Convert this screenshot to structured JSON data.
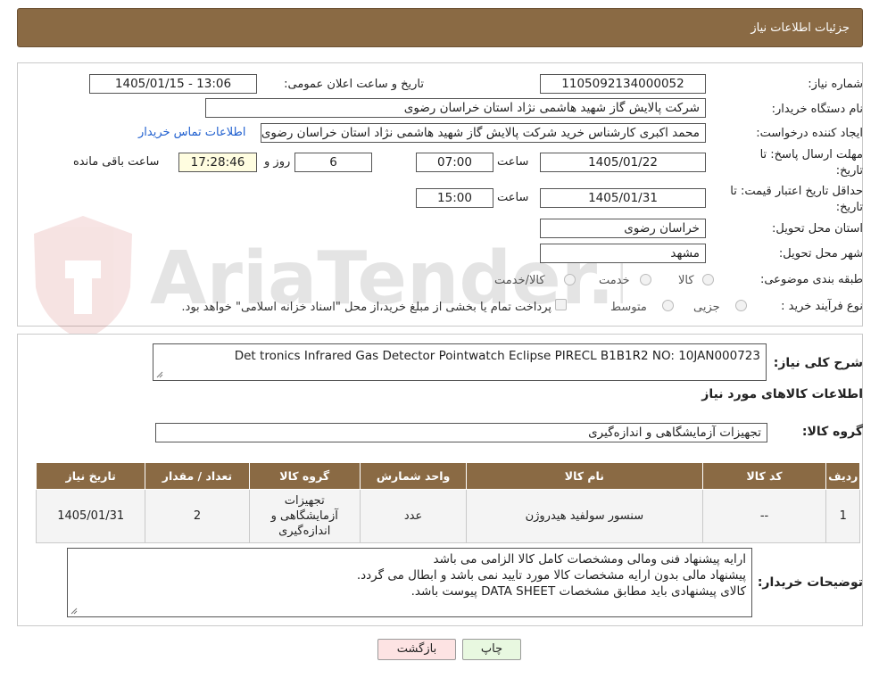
{
  "header": {
    "title": "جزئیات اطلاعات نیاز"
  },
  "form": {
    "need_number_label": "شماره نیاز:",
    "need_number": "1105092134000052",
    "announce_label": "تاریخ و ساعت اعلان عمومی:",
    "announce_value": "1405/01/15 - 13:06",
    "buyer_org_label": "نام دستگاه خریدار:",
    "buyer_org": "شرکت پالایش گاز شهید هاشمی نژاد   استان خراسان رضوی",
    "creator_label": "ایجاد کننده درخواست:",
    "creator": "محمد اکبری کارشناس خرید شرکت پالایش گاز شهید هاشمی نژاد   استان خراسان رضوی",
    "contact_link": "اطلاعات تماس خریدار",
    "deadline_label": "مهلت ارسال پاسخ: تا تاریخ:",
    "deadline_date": "1405/01/22",
    "time_label": "ساعت",
    "deadline_time": "07:00",
    "days_value": "6",
    "days_label": "روز و",
    "remaining_time": "17:28:46",
    "remaining_label": "ساعت باقی مانده",
    "validity_label": "حداقل تاریخ اعتبار قیمت: تا تاریخ:",
    "validity_date": "1405/01/31",
    "validity_time": "15:00",
    "province_label": "استان محل تحویل:",
    "province": "خراسان رضوی",
    "city_label": "شهر محل تحویل:",
    "city": "مشهد",
    "category_label": "طبقه بندی موضوعی:",
    "category_options": [
      "کالا",
      "خدمت",
      "کالا/خدمت"
    ],
    "process_label": "نوع فرآیند خرید :",
    "process_options": [
      "جزیی",
      "متوسط"
    ],
    "payment_note": "پرداخت تمام یا بخشی از مبلغ خرید،از محل \"اسناد خزانه اسلامی\" خواهد بود."
  },
  "details": {
    "summary_label": "شرح کلی نیاز:",
    "summary": "Det tronics Infrared Gas Detector Pointwatch Eclipse PIRECL B1B1R2 NO: 10JAN000723",
    "goods_info_title": "اطلاعات کالاهای مورد نیاز",
    "goods_group_label": "گروه کالا:",
    "goods_group": "تجهیزات آزمایشگاهی و اندازه‌گیری"
  },
  "table": {
    "headers": [
      "ردیف",
      "کد کالا",
      "نام کالا",
      "واحد شمارش",
      "گروه کالا",
      "تعداد / مقدار",
      "تاریخ نیاز"
    ],
    "rows": [
      [
        "1",
        "--",
        "سنسور سولفید هیدروژن",
        "عدد",
        "تجهیزات آزمایشگاهی و اندازه‌گیری",
        "2",
        "1405/01/31"
      ]
    ]
  },
  "buyer_notes": {
    "label": "توضیحات خریدار:",
    "lines": [
      "ارایه پیشنهاد فنی ومالی ومشخصات کامل کالا الزامی می باشد",
      "پیشنهاد مالی بدون ارایه مشخصات کالا مورد تایید نمی باشد و ابطال می گردد.",
      "کالای پیشنهادی باید مطابق مشخصات DATA SHEET پیوست باشد."
    ]
  },
  "buttons": {
    "print": "چاپ",
    "back": "بازگشت"
  },
  "watermark": {
    "text": "AriaTender.neT"
  },
  "colors": {
    "header_bg": "#8a6a44",
    "link": "#1f5fcf",
    "back_bg": "#fde3e3",
    "print_bg": "#e8f8e0"
  }
}
